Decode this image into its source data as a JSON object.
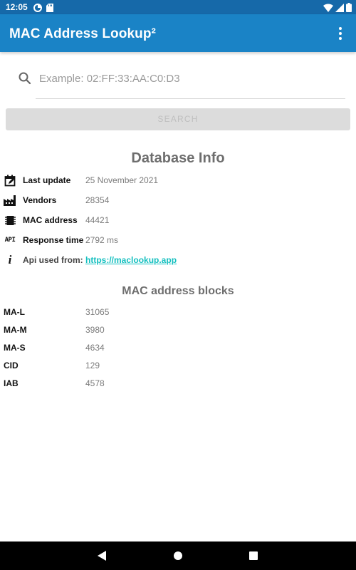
{
  "status_bar": {
    "time": "12:05",
    "icons_left": [
      "data-saver-icon",
      "sd-card-icon"
    ],
    "icons_right": [
      "wifi-icon",
      "cell-signal-icon",
      "battery-icon"
    ]
  },
  "app_bar": {
    "title": "MAC Address Lookup²",
    "menu_icon": "overflow-menu-icon"
  },
  "search": {
    "placeholder": "Example: 02:FF:33:AA:C0:D3",
    "value": "",
    "button_label": "SEARCH"
  },
  "database_info": {
    "title": "Database Info",
    "rows": [
      {
        "icon": "calendar-edit-icon",
        "label": "Last update",
        "value": "25 November 2021"
      },
      {
        "icon": "factory-icon",
        "label": "Vendors",
        "value": "28354"
      },
      {
        "icon": "chip-icon",
        "label": "MAC address",
        "value": "44421"
      },
      {
        "icon": "api-icon",
        "icon_text": "API",
        "label": "Response time",
        "value": "2792 ms"
      }
    ],
    "api_source": {
      "icon": "info-icon",
      "icon_text": "i",
      "label": "Api used from: ",
      "link": "https://maclookup.app"
    }
  },
  "mac_blocks": {
    "title": "MAC address blocks",
    "rows": [
      {
        "label": "MA-L",
        "value": "31065"
      },
      {
        "label": "MA-M",
        "value": "3980"
      },
      {
        "label": "MA-S",
        "value": "4634"
      },
      {
        "label": "CID",
        "value": "129"
      },
      {
        "label": "IAB",
        "value": "4578"
      }
    ]
  },
  "colors": {
    "status_bar": "#1669a9",
    "app_bar": "#1a83c6",
    "link": "#13bfbf",
    "button_disabled": "#dcdcdc"
  },
  "nav_bar": {
    "icons": [
      "back-icon",
      "home-icon",
      "recents-icon"
    ]
  }
}
